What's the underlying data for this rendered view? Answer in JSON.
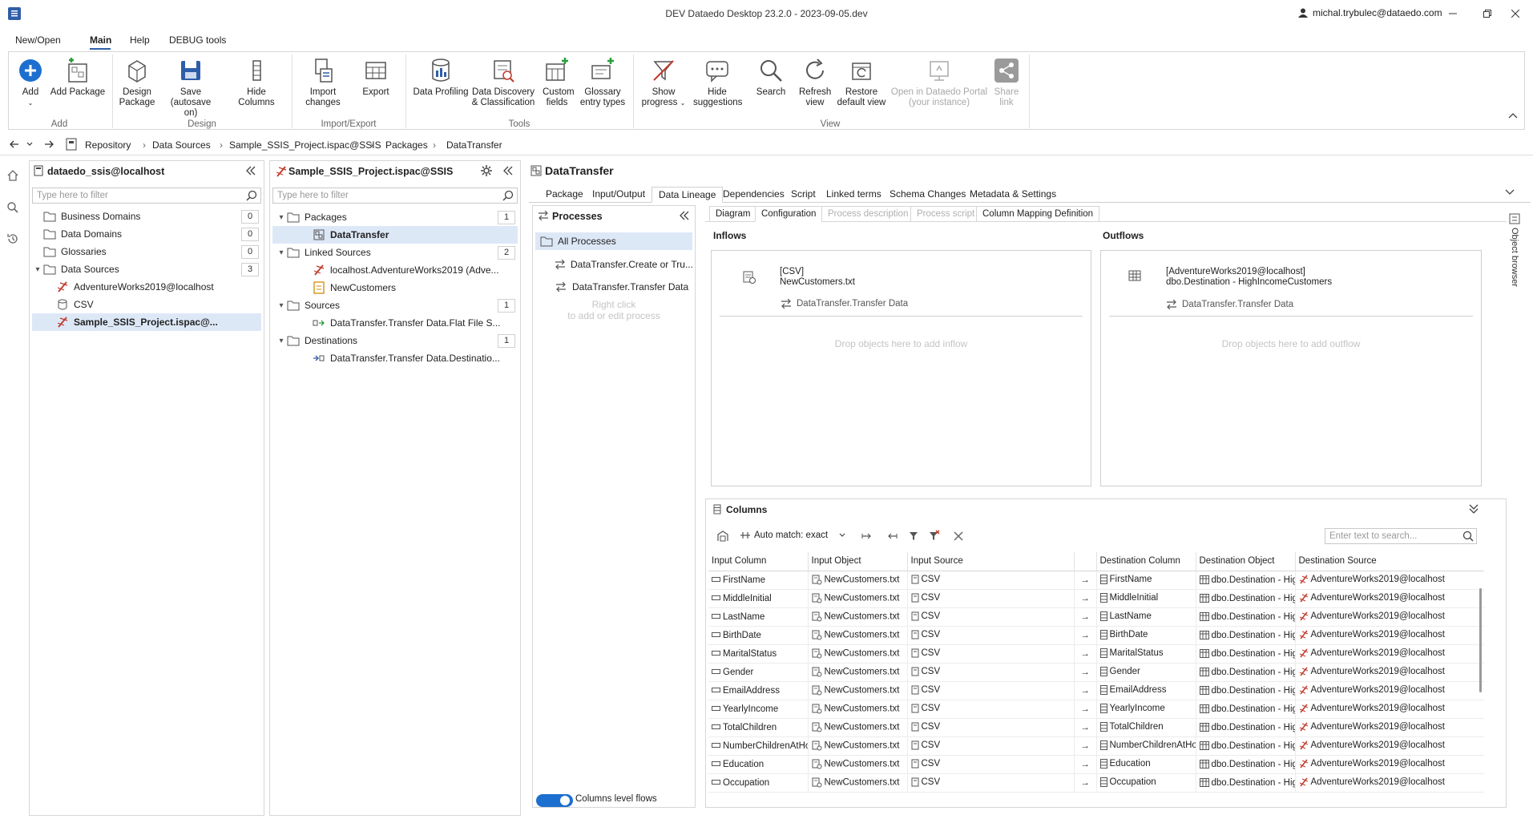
{
  "window": {
    "title": "DEV Dataedo Desktop 23.2.0 - 2023-09-05.dev",
    "user": "michal.trybulec@dataedo.com"
  },
  "menu": {
    "tabs": [
      {
        "label": "New/Open"
      },
      {
        "label": "Main"
      },
      {
        "label": "Help"
      },
      {
        "label": "DEBUG tools"
      }
    ]
  },
  "ribbon": {
    "add": "Add",
    "add_package": "Add Package",
    "design_package": "Design Package",
    "save": "Save (autosave on)",
    "hide_columns": "Hide Columns",
    "import_changes": "Import changes",
    "export": "Export",
    "data_profiling": "Data Profiling",
    "data_discovery": "Data Discovery & Classification",
    "custom_fields": "Custom fields",
    "glossary_entry_types": "Glossary entry types",
    "show_progress": "Show progress",
    "hide_suggestions": "Hide suggestions",
    "search": "Search",
    "refresh_view": "Refresh view",
    "restore_default_view": "Restore default view",
    "open_portal": "Open in Dataedo Portal (your instance)",
    "share_link": "Share link",
    "groups": {
      "add": "Add",
      "design": "Design",
      "import_export": "Import/Export",
      "tools": "Tools",
      "view": "View"
    }
  },
  "breadcrumb": [
    "Repository",
    "Data Sources",
    "Sample_SSIS_Project.ispac@SSIS",
    "Packages",
    "DataTransfer"
  ],
  "repo_panel": {
    "title": "dataedo_ssis@localhost",
    "filter_placeholder": "Type here to filter",
    "items": [
      {
        "label": "Business Domains",
        "count": "0"
      },
      {
        "label": "Data Domains",
        "count": "0"
      },
      {
        "label": "Glossaries",
        "count": "0"
      },
      {
        "label": "Data Sources",
        "count": "3"
      },
      {
        "label": "AdventureWorks2019@localhost"
      },
      {
        "label": "CSV"
      },
      {
        "label": "Sample_SSIS_Project.ispac@..."
      }
    ]
  },
  "project_panel": {
    "title": "Sample_SSIS_Project.ispac@SSIS",
    "filter_placeholder": "Type here to filter",
    "items": [
      {
        "label": "Packages",
        "count": "1"
      },
      {
        "label": "DataTransfer"
      },
      {
        "label": "Linked Sources",
        "count": "2"
      },
      {
        "label": "localhost.AdventureWorks2019 (Adve..."
      },
      {
        "label": "NewCustomers"
      },
      {
        "label": "Sources",
        "count": "1"
      },
      {
        "label": "DataTransfer.Transfer Data.Flat File S..."
      },
      {
        "label": "Destinations",
        "count": "1"
      },
      {
        "label": "DataTransfer.Transfer Data.Destinatio..."
      }
    ]
  },
  "object": {
    "title": "DataTransfer",
    "tabs": [
      {
        "label": "Package"
      },
      {
        "label": "Input/Output"
      },
      {
        "label": "Data Lineage"
      },
      {
        "label": "Dependencies"
      },
      {
        "label": "Script"
      },
      {
        "label": "Linked terms"
      },
      {
        "label": "Schema Changes"
      },
      {
        "label": "Metadata & Settings"
      }
    ],
    "subtabs": [
      {
        "label": "Diagram"
      },
      {
        "label": "Configuration"
      },
      {
        "label": "Process description"
      },
      {
        "label": "Process script"
      },
      {
        "label": "Column Mapping Definition"
      }
    ]
  },
  "processes": {
    "title": "Processes",
    "all": "All Processes",
    "items": [
      "DataTransfer.Create or Tru...",
      "DataTransfer.Transfer Data"
    ],
    "hint1": "Right click",
    "hint2": "to add or edit process",
    "toggle_label": "Columns level flows",
    "toggle_on": true
  },
  "inflows": {
    "title": "Inflows",
    "item_line1": "[CSV]",
    "item_line2": "NewCustomers.txt",
    "process": "DataTransfer.Transfer Data",
    "drop_hint": "Drop objects here to add inflow"
  },
  "outflows": {
    "title": "Outflows",
    "item_line1": "[AdventureWorks2019@localhost]",
    "item_line2": "dbo.Destination - HighIncomeCustomers",
    "process": "DataTransfer.Transfer Data",
    "drop_hint": "Drop objects here to add outflow"
  },
  "columns_panel": {
    "title": "Columns",
    "auto_match": "Auto match: exact",
    "search_placeholder": "Enter text to search...",
    "headers": [
      "Input Column",
      "Input Object",
      "Input Source",
      "",
      "Destination Column",
      "Destination Object",
      "Destination Source"
    ],
    "rows": [
      [
        "FirstName",
        "NewCustomers.txt",
        "CSV",
        "→",
        "FirstName",
        "dbo.Destination - Hig",
        "AdventureWorks2019@localhost"
      ],
      [
        "MiddleInitial",
        "NewCustomers.txt",
        "CSV",
        "→",
        "MiddleInitial",
        "dbo.Destination - Hig",
        "AdventureWorks2019@localhost"
      ],
      [
        "LastName",
        "NewCustomers.txt",
        "CSV",
        "→",
        "LastName",
        "dbo.Destination - Hig",
        "AdventureWorks2019@localhost"
      ],
      [
        "BirthDate",
        "NewCustomers.txt",
        "CSV",
        "→",
        "BirthDate",
        "dbo.Destination - Hig",
        "AdventureWorks2019@localhost"
      ],
      [
        "MaritalStatus",
        "NewCustomers.txt",
        "CSV",
        "→",
        "MaritalStatus",
        "dbo.Destination - Hig",
        "AdventureWorks2019@localhost"
      ],
      [
        "Gender",
        "NewCustomers.txt",
        "CSV",
        "→",
        "Gender",
        "dbo.Destination - Hig",
        "AdventureWorks2019@localhost"
      ],
      [
        "EmailAddress",
        "NewCustomers.txt",
        "CSV",
        "→",
        "EmailAddress",
        "dbo.Destination - Hig",
        "AdventureWorks2019@localhost"
      ],
      [
        "YearlyIncome",
        "NewCustomers.txt",
        "CSV",
        "→",
        "YearlyIncome",
        "dbo.Destination - Hig",
        "AdventureWorks2019@localhost"
      ],
      [
        "TotalChildren",
        "NewCustomers.txt",
        "CSV",
        "→",
        "TotalChildren",
        "dbo.Destination - Hig",
        "AdventureWorks2019@localhost"
      ],
      [
        "NumberChildrenAtHo",
        "NewCustomers.txt",
        "CSV",
        "→",
        "NumberChildrenAtHo",
        "dbo.Destination - Hig",
        "AdventureWorks2019@localhost"
      ],
      [
        "Education",
        "NewCustomers.txt",
        "CSV",
        "→",
        "Education",
        "dbo.Destination - Hig",
        "AdventureWorks2019@localhost"
      ],
      [
        "Occupation",
        "NewCustomers.txt",
        "CSV",
        "→",
        "Occupation",
        "dbo.Destination - Hig",
        "AdventureWorks2019@localhost"
      ]
    ]
  },
  "side_rail": {
    "object_browser": "Object browser"
  },
  "colors": {
    "accent": "#2f5ea8",
    "toggle": "#1d6fcf",
    "selection": "#dde8f7",
    "ssis_red": "#c0392b"
  }
}
